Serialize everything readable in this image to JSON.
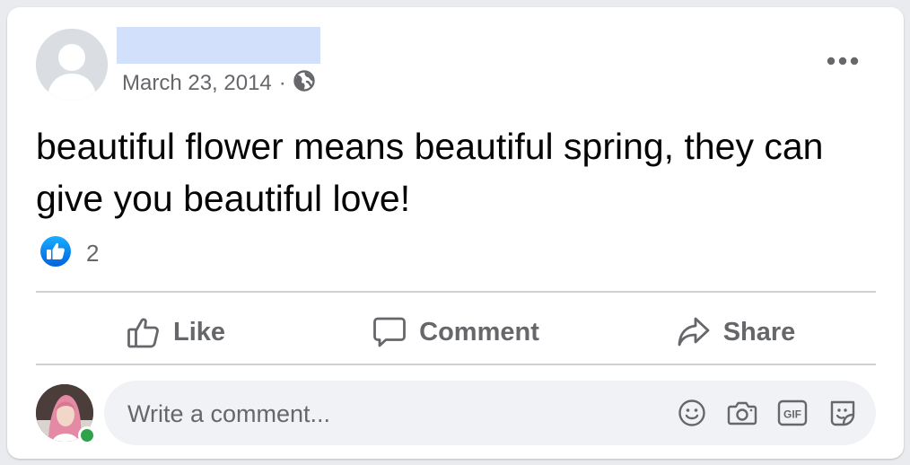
{
  "post": {
    "author_name": "",
    "date": "March 23, 2014",
    "separator": "·",
    "privacy_icon": "globe-icon",
    "text": "beautiful flower means beautiful spring, they can give you beautiful love!",
    "reactions": {
      "icon": "like-reaction-icon",
      "count": "2"
    }
  },
  "actions": {
    "like_label": "Like",
    "comment_label": "Comment",
    "share_label": "Share"
  },
  "comment_box": {
    "placeholder": "Write a comment...",
    "icons": [
      "emoji-icon",
      "camera-icon",
      "gif-icon",
      "sticker-icon"
    ]
  },
  "colors": {
    "like_blue": "#1877f2",
    "online_green": "#31a24c",
    "secondary_text": "#65676b"
  }
}
